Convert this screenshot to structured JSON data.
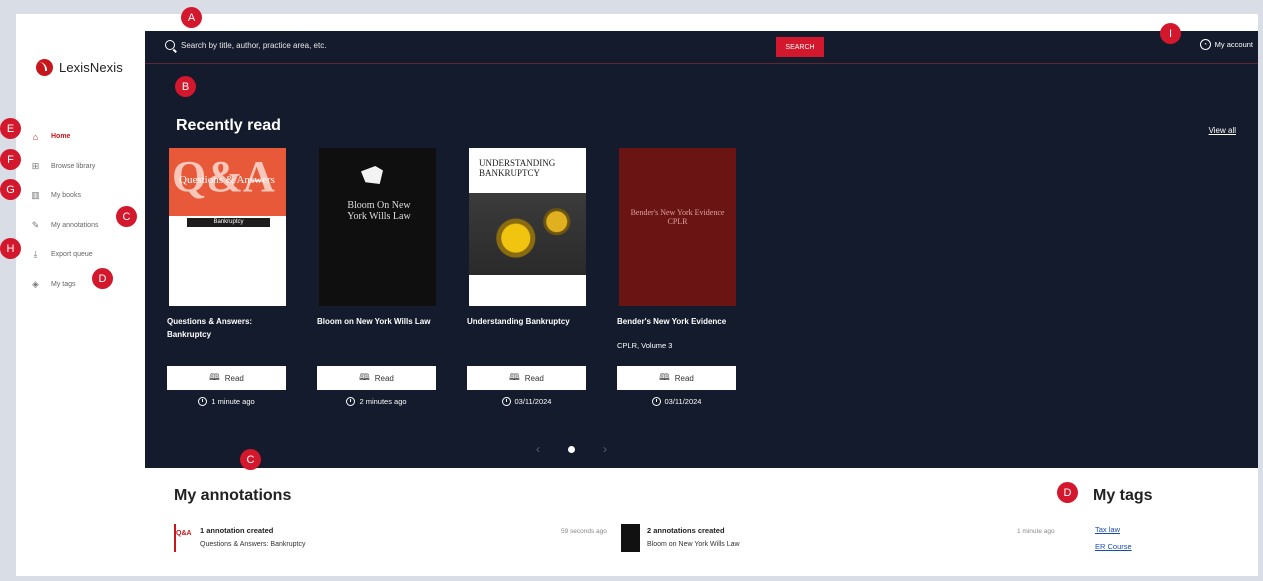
{
  "sidebar": {
    "logo": "LexisNexis",
    "items": [
      {
        "label": "Home",
        "icon": "home-icon"
      },
      {
        "label": "Browse library",
        "icon": "library-icon"
      },
      {
        "label": "My books",
        "icon": "books-icon"
      },
      {
        "label": "My annotations",
        "icon": "pencil-icon"
      },
      {
        "label": "Export queue",
        "icon": "download-icon"
      },
      {
        "label": "My tags",
        "icon": "tag-icon"
      }
    ]
  },
  "header": {
    "search_placeholder": "Search by title, author, practice area, etc.",
    "search_button": "SEARCH",
    "account": "My account"
  },
  "recent": {
    "title": "Recently read",
    "view_all": "View all",
    "read_label": "Read",
    "books": [
      {
        "title": "Questions & Answers: Bankruptcy",
        "subtitle": "",
        "time": "1 minute ago"
      },
      {
        "title": "Bloom on New York Wills Law",
        "subtitle": "",
        "time": "2 minutes ago"
      },
      {
        "title": "Understanding Bankruptcy",
        "subtitle": "",
        "time": "03/11/2024"
      },
      {
        "title": "Bender's New York Evidence",
        "subtitle": "CPLR, Volume 3",
        "time": "03/11/2024"
      }
    ],
    "covers": {
      "c1_big": "Q&A",
      "c1_small": "Questions & Answers",
      "c1_topic": "Bankruptcy",
      "c2": "Bloom On New York Wills Law",
      "c3": "UNDERSTANDING BANKRUPTCY",
      "c4": "Bender's New York Evidence CPLR"
    }
  },
  "annotations": {
    "title": "My annotations",
    "items": [
      {
        "thumb": "Q&A",
        "title": "1 annotation created",
        "book": "Questions & Answers: Bankruptcy",
        "time": "59 seconds ago"
      },
      {
        "thumb": "",
        "title": "2 annotations created",
        "book": "Bloom on New York Wills Law",
        "time": "1 minute ago"
      }
    ]
  },
  "tags": {
    "title": "My tags",
    "items": [
      "Tax law",
      "ER Course"
    ]
  },
  "markers": {
    "a": "A",
    "b": "B",
    "c_nav": "C",
    "d_nav": "D",
    "c_ann": "C",
    "d_tags": "D",
    "e": "E",
    "f": "F",
    "g": "G",
    "h": "H",
    "i": "I"
  },
  "colors": {
    "accent": "#d3172c",
    "main_bg": "#141b2d",
    "link": "#1a4db3"
  }
}
